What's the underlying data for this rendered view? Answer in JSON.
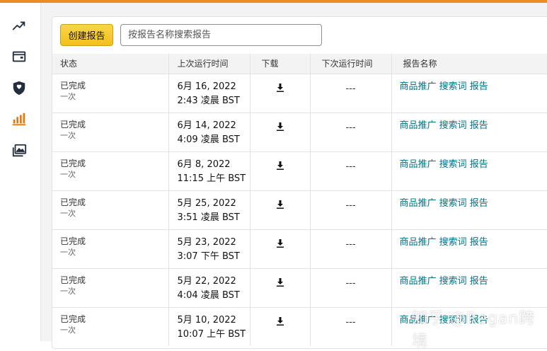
{
  "sidebar": {
    "items": [
      {
        "icon": "trend-chart-icon"
      },
      {
        "icon": "wallet-icon"
      },
      {
        "icon": "shield-icon"
      },
      {
        "icon": "bar-chart-icon",
        "active": true
      },
      {
        "icon": "image-gallery-icon"
      }
    ],
    "active_color": "#e47911",
    "color": "#232f3e"
  },
  "toolbar": {
    "create_label": "创建报告",
    "search_placeholder": "按报告名称搜索报告"
  },
  "table": {
    "headers": [
      "状态",
      "上次运行时间",
      "下载",
      "下次运行时间",
      "报告名称"
    ],
    "rows": [
      {
        "status": "已完成",
        "frequency": "一次",
        "last_run_date": "6月 16, 2022",
        "last_run_time": "2:43 凌晨 BST",
        "next_run": "---",
        "name": "商品推广 搜索词 报告"
      },
      {
        "status": "已完成",
        "frequency": "一次",
        "last_run_date": "6月 14, 2022",
        "last_run_time": "4:09 凌晨 BST",
        "next_run": "---",
        "name": "商品推广 搜索词 报告"
      },
      {
        "status": "已完成",
        "frequency": "一次",
        "last_run_date": "6月 8, 2022",
        "last_run_time": "11:15 上午 BST",
        "next_run": "---",
        "name": "商品推广 搜索词 报告"
      },
      {
        "status": "已完成",
        "frequency": "一次",
        "last_run_date": "5月 25, 2022",
        "last_run_time": "3:51 凌晨 BST",
        "next_run": "---",
        "name": "商品推广 搜索词 报告"
      },
      {
        "status": "已完成",
        "frequency": "一次",
        "last_run_date": "5月 23, 2022",
        "last_run_time": "3:07 下午 BST",
        "next_run": "---",
        "name": "商品推广 搜索词 报告"
      },
      {
        "status": "已完成",
        "frequency": "一次",
        "last_run_date": "5月 22, 2022",
        "last_run_time": "4:04 凌晨 BST",
        "next_run": "---",
        "name": "商品推广 搜索词 报告"
      },
      {
        "status": "已完成",
        "frequency": "一次",
        "last_run_date": "5月 10, 2022",
        "last_run_time": "10:07 上午 BST",
        "next_run": "---",
        "name": "商品推广 搜索词 报告"
      }
    ]
  },
  "watermark": "知乎 @Regan跨境",
  "colors": {
    "accent": "#f08a24",
    "button": "#f7ca00",
    "link": "#007185"
  }
}
